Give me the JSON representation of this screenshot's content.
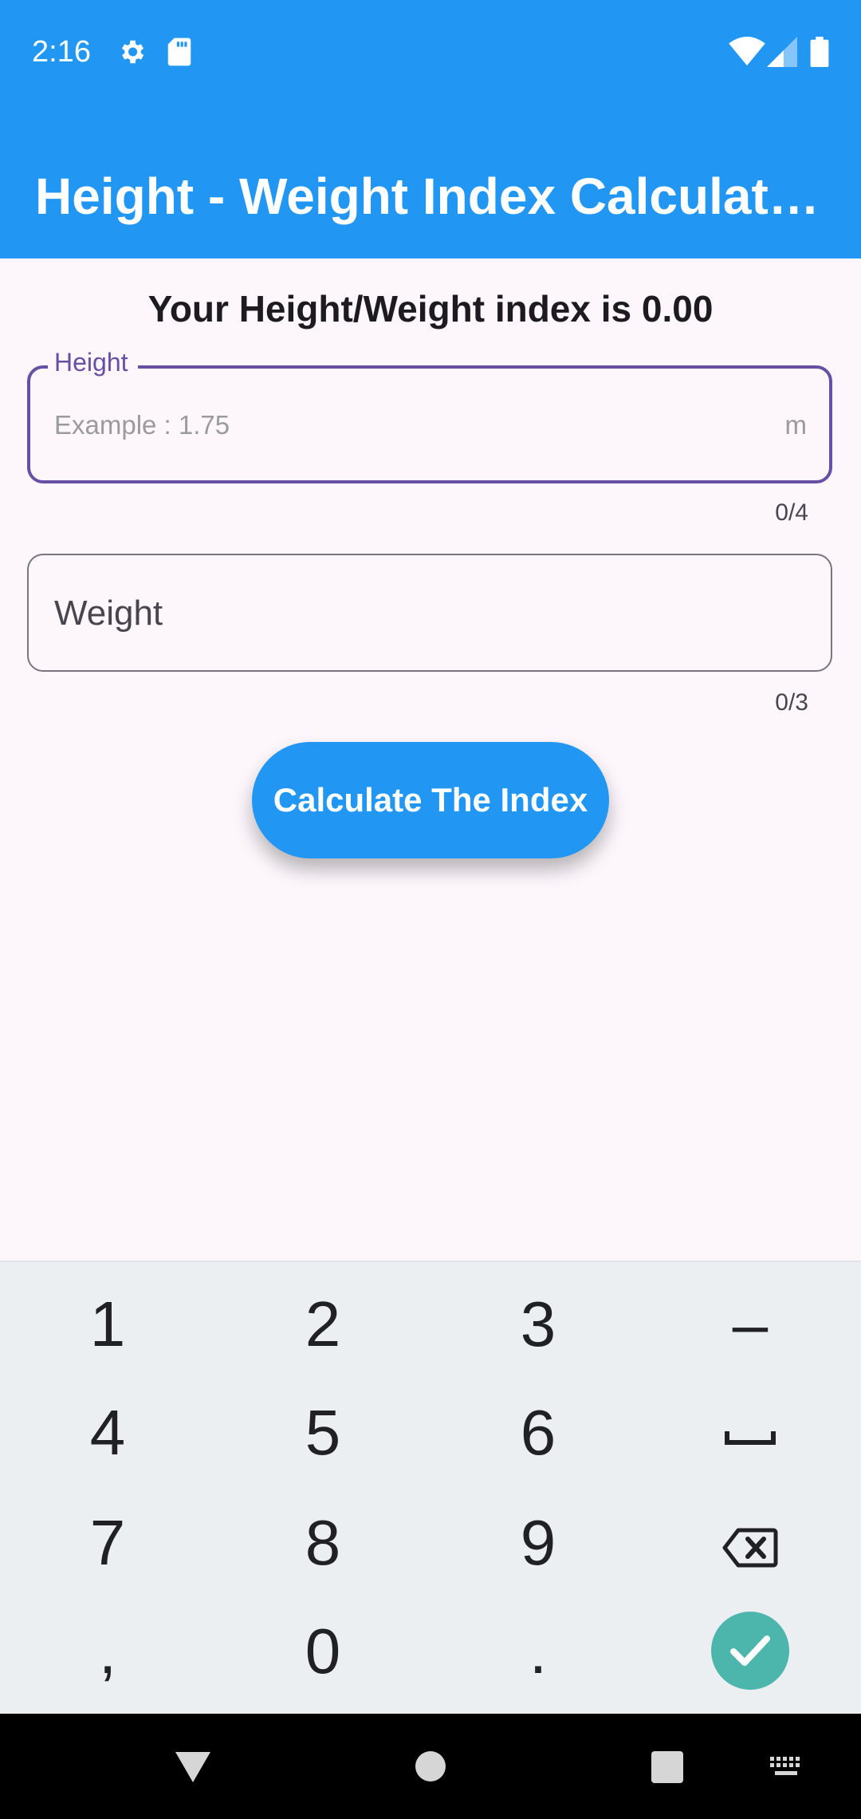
{
  "status_bar": {
    "time": "2:16",
    "icons": [
      "settings-icon",
      "sd-card-icon",
      "wifi-icon",
      "cell-signal-icon",
      "battery-icon"
    ]
  },
  "app_bar": {
    "title": "Height - Weight Index Calculat…"
  },
  "result": {
    "text": "Your Height/Weight index is 0.00"
  },
  "height_field": {
    "label": "Height",
    "placeholder": "Example : 1.75",
    "suffix": "m",
    "counter": "0/4"
  },
  "weight_field": {
    "label": "Weight",
    "counter": "0/3"
  },
  "calculate_button": {
    "label": "Calculate The Index"
  },
  "keyboard": {
    "keys": [
      "1",
      "2",
      "3",
      "–",
      "4",
      "5",
      "6",
      "␣",
      "7",
      "8",
      "9",
      "⌫",
      ",",
      "0",
      ".",
      "✓"
    ]
  },
  "colors": {
    "primary": "#2196f3",
    "focus": "#6750a4",
    "background": "#fdf7fc",
    "keyboard_bg": "#eceff1",
    "done_key": "#4db6ac"
  }
}
